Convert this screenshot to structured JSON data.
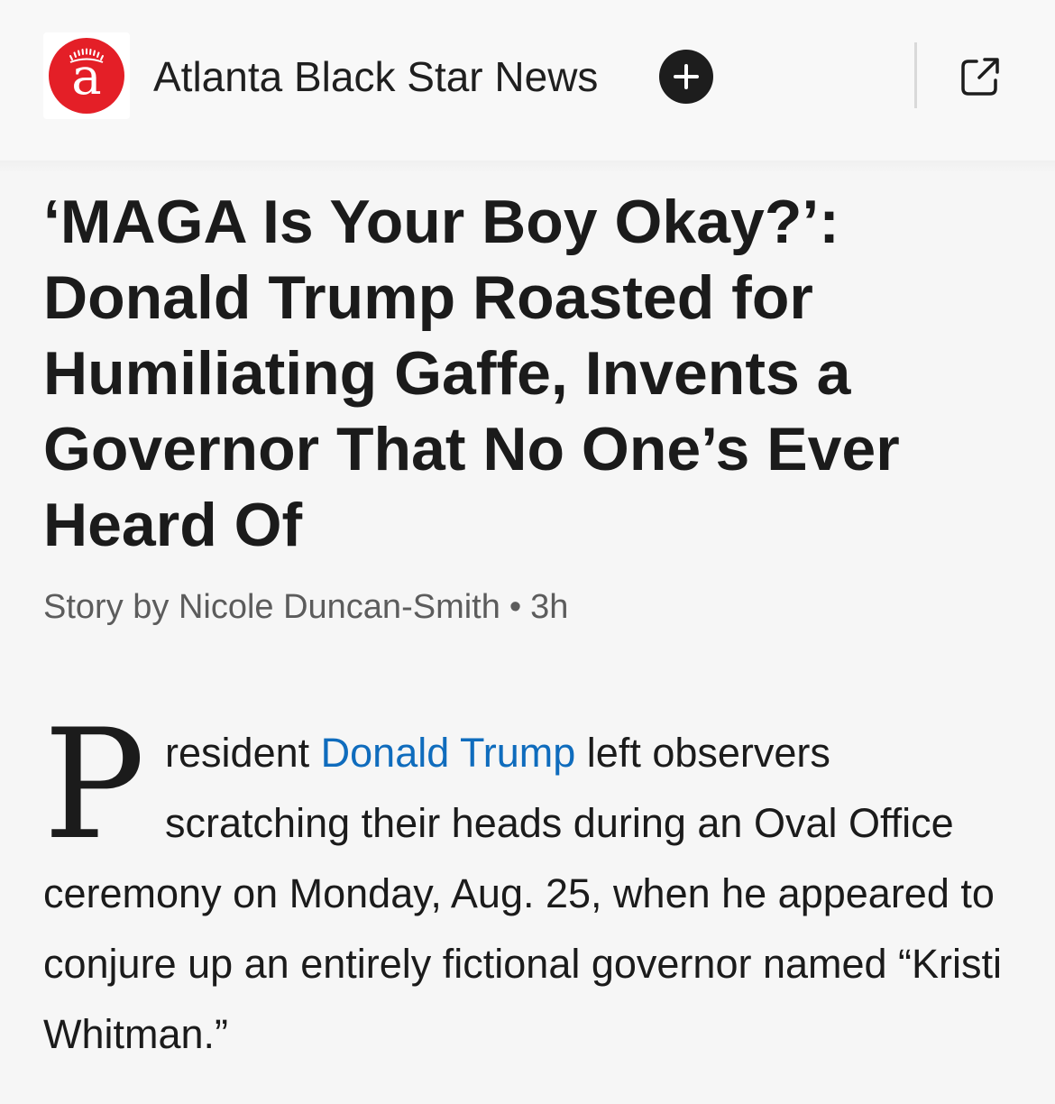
{
  "header": {
    "logo_letter": "a",
    "publisher_name": "Atlanta Black Star News",
    "follow_icon": "plus-icon",
    "share_icon": "open-external-icon",
    "brand_color": "#e41f27"
  },
  "article": {
    "headline": "‘MAGA Is Your Boy Okay?’: Donald Trump Roasted for Humiliating Gaffe, Invents a Governor That No One’s Ever Heard Of",
    "byline_author": "Story by Nicole Duncan-Smith",
    "byline_separator": "•",
    "byline_age": "3h",
    "body": {
      "drop_cap": "P",
      "text_before_link": "resident ",
      "link_text": "Donald Trump",
      "text_after_link": " left observers scratching their heads during an Oval Office ceremony on Monday, Aug. 25, when he appeared to conjure up an entirely fictional governor named “Kristi Whitman.”",
      "link_color": "#0f6cbd"
    }
  }
}
